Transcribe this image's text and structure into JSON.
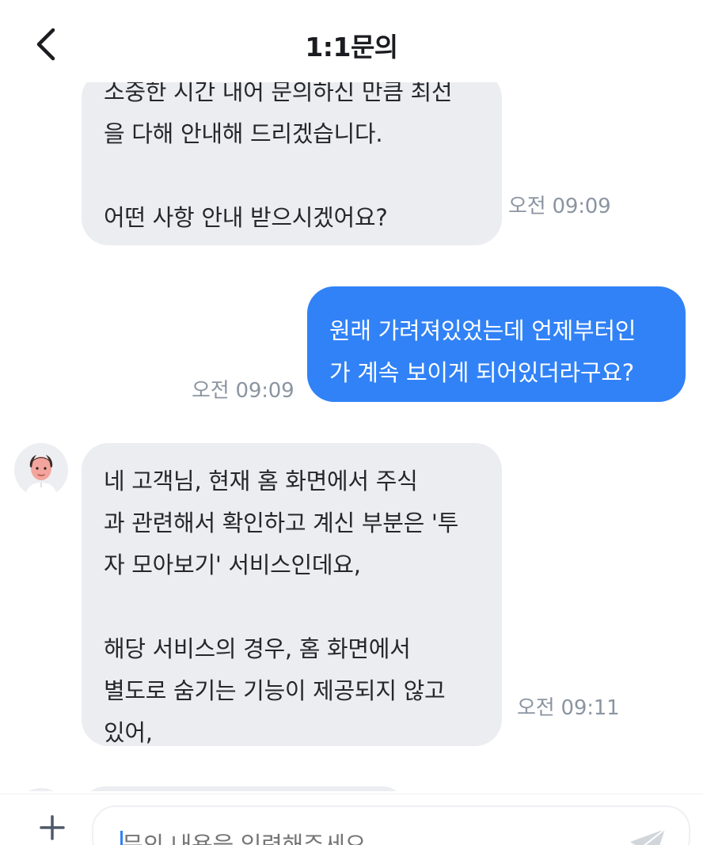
{
  "header": {
    "title": "1:1문의"
  },
  "messages": [
    {
      "sender": "agent",
      "text": "소중한 시간 내어 문의하신 만큼 최선\n을 다해 안내해 드리겠습니다.\n\n어떤 사항 안내 받으시겠어요?",
      "time": "오전 09:09"
    },
    {
      "sender": "user",
      "text": "원래 가려져있었는데 언제부터인\n가 계속 보이게 되어있더라구요?",
      "time": "오전 09:09"
    },
    {
      "sender": "agent",
      "text": "네 고객님, 현재         홈 화면에서 주식\n과 관련해서 확인하고 계신 부분은 '투\n자 모아보기' 서비스인데요,\n\n해당 서비스의 경우,          홈 화면에서\n별도로 숨기는 기능이 제공되지 않고\n있어,",
      "time": "오전 09:11"
    }
  ],
  "input": {
    "placeholder": "문의 내용을 입력해주세요"
  },
  "colors": {
    "user_bubble": "#3182f6",
    "agent_bubble": "#ebedf0",
    "timestamp": "#8b95a1"
  },
  "icons": {
    "back": "chevron-left-icon",
    "plus": "plus-icon",
    "send": "send-icon",
    "avatar": "agent-avatar"
  }
}
